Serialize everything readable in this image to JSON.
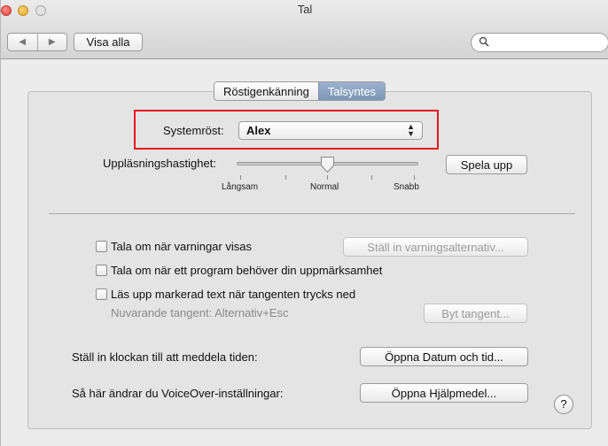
{
  "window": {
    "title": "Tal"
  },
  "toolbar": {
    "back_icon": "back-arrow-icon",
    "forward_icon": "forward-arrow-icon",
    "show_all": "Visa alla",
    "search_placeholder": ""
  },
  "tabs": [
    {
      "label": "Röstigenkänning",
      "active": false
    },
    {
      "label": "Talsyntes",
      "active": true
    }
  ],
  "voice": {
    "label": "Systemröst:",
    "selected": "Alex"
  },
  "rate": {
    "label": "Uppläsningshastighet:",
    "level": 0.5,
    "slow": "Långsam",
    "normal": "Normal",
    "fast": "Snabb",
    "play_button": "Spela upp"
  },
  "options": {
    "alerts": {
      "label": "Tala om när varningar visas",
      "checked": false,
      "button": "Ställ in varningsalternativ..."
    },
    "attention": {
      "label": "Tala om när ett program behöver din uppmärksamhet",
      "checked": false
    },
    "selected_text": {
      "label": "Läs upp markerad text när tangenten trycks ned",
      "checked": false,
      "current_key": "Nuvarande tangent: Alternativ+Esc",
      "button": "Byt tangent..."
    }
  },
  "clock": {
    "label": "Ställ in klockan till att meddela tiden:",
    "button": "Öppna Datum och tid..."
  },
  "voiceover": {
    "label": "Så här ändrar du VoiceOver-inställningar:",
    "button": "Öppna Hjälpmedel..."
  },
  "help": {
    "symbol": "?"
  },
  "colors": {
    "highlight": "#e5191c",
    "active_tab": "#8aa3c4"
  }
}
